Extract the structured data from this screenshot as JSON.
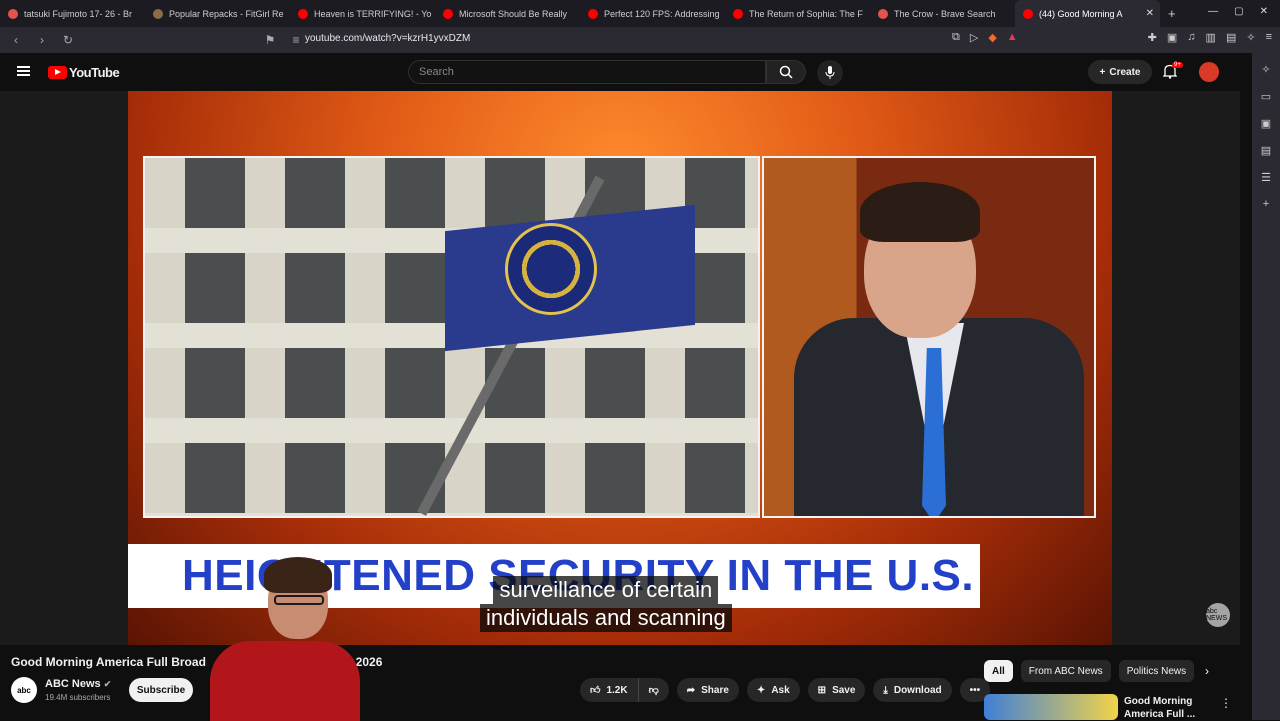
{
  "tabs": [
    {
      "label": "tatsuki Fujimoto 17- 26 - Br",
      "color": "#e2554c"
    },
    {
      "label": "Popular Repacks - FitGirl Re",
      "color": "#8a6b4a"
    },
    {
      "label": "Heaven is TERRIFYING! - Yo",
      "color": "#ff0000"
    },
    {
      "label": "Microsoft Should Be Really",
      "color": "#ff0000"
    },
    {
      "label": "Perfect 120 FPS: Addressing",
      "color": "#ff0000"
    },
    {
      "label": "The Return of Sophia: The F",
      "color": "#ff0000"
    },
    {
      "label": "The Crow - Brave Search",
      "color": "#e2554c"
    },
    {
      "label": "(44) Good Morning A",
      "color": "#ff0000",
      "active": true
    }
  ],
  "address": {
    "url": "youtube.com/watch?v=kzrH1yvxDZM"
  },
  "youtube": {
    "logo_text": "YouTube",
    "search_placeholder": "Search",
    "create_label": "Create",
    "notifications_badge": "9+"
  },
  "video": {
    "headline": "HEIGHTENED SECURITY IN THE U.S.",
    "caption_lines": [
      "surveillance of certain",
      "individuals and scanning"
    ],
    "watermark": "abc NEWS"
  },
  "meta": {
    "title_left": "Good Morning America Full Broad",
    "title_right": "ch 1, 2026",
    "channel_name": "ABC News",
    "channel_avatar": "abc",
    "subscribers": "19.4M subscribers",
    "subscribe_label": "Subscribe",
    "likes": "1.2K",
    "share_label": "Share",
    "ask_label": "Ask",
    "save_label": "Save",
    "download_label": "Download"
  },
  "chips": [
    "All",
    "From ABC News",
    "Politics News"
  ],
  "recommendation": {
    "title": "Good Morning America Full ..."
  }
}
